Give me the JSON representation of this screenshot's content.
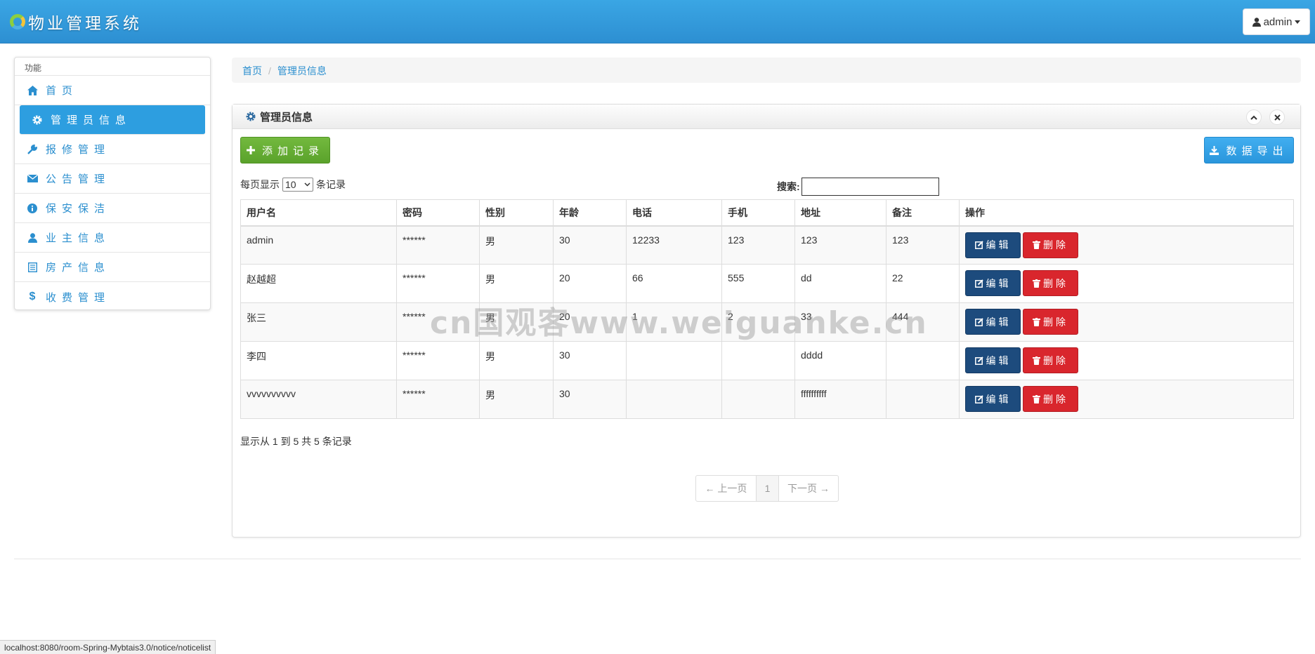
{
  "app": {
    "title": "物业管理系统"
  },
  "user_menu": {
    "label": "admin"
  },
  "sidebar": {
    "header": "功能",
    "items": [
      {
        "label": "首页",
        "icon": "home-icon"
      },
      {
        "label": "管理员信息",
        "icon": "gear-icon"
      },
      {
        "label": "报修管理",
        "icon": "wrench-icon"
      },
      {
        "label": "公告管理",
        "icon": "envelope-icon"
      },
      {
        "label": "保安保洁",
        "icon": "info-icon"
      },
      {
        "label": "业主信息",
        "icon": "user-icon"
      },
      {
        "label": "房产信息",
        "icon": "list-icon"
      },
      {
        "label": "收费管理",
        "icon": "dollar-icon"
      }
    ]
  },
  "breadcrumb": {
    "home": "首页",
    "current": "管理员信息"
  },
  "panel": {
    "title": "管理员信息",
    "add_label": "添加记录",
    "export_label": "数据导出"
  },
  "length_control": {
    "prefix": "每页显示",
    "value": "10",
    "suffix": "条记录"
  },
  "search": {
    "label": "搜索:",
    "value": ""
  },
  "table": {
    "headers": [
      "用户名",
      "密码",
      "性别",
      "年龄",
      "电话",
      "手机",
      "地址",
      "备注",
      "操作"
    ],
    "edit_label": "编辑",
    "delete_label": "删除",
    "rows": [
      [
        "admin",
        "******",
        "男",
        "30",
        "12233",
        "123",
        "123",
        "123"
      ],
      [
        "赵越超",
        "******",
        "男",
        "20",
        "66",
        "555",
        "dd",
        "22"
      ],
      [
        "张三",
        "******",
        "男",
        "20",
        "1",
        "2",
        "33",
        "444"
      ],
      [
        "李四",
        "******",
        "男",
        "30",
        "",
        "",
        "dddd",
        ""
      ],
      [
        "vvvvvvvvvv",
        "******",
        "男",
        "30",
        "",
        "",
        "ffffffffff",
        ""
      ]
    ]
  },
  "info": "显示从 1 到 5 共 5 条记录",
  "pagination": {
    "prev": "← 上一页",
    "current": "1",
    "next": "下一页 →"
  },
  "watermark": "cn国观客www.weiguanke.cn",
  "status_url": "localhost:8080/room-Spring-Mybtais3.0/notice/noticelist",
  "colors": {
    "navbar": "#3aa6e4",
    "accent": "#2d9ee0",
    "add": "#5aa22b",
    "edit": "#1d4b7d",
    "delete": "#d9262d"
  }
}
